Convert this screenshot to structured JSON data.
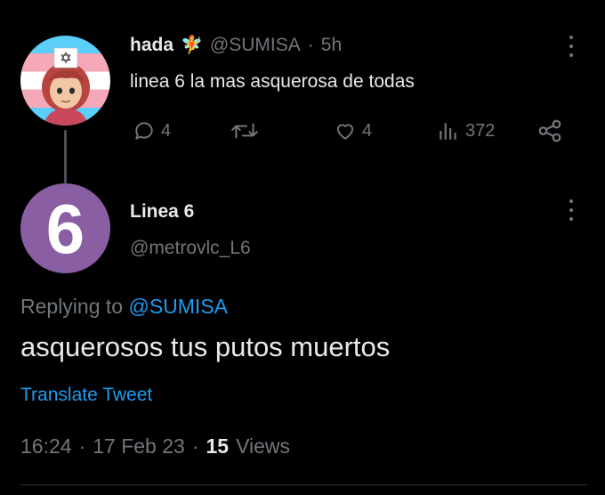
{
  "parent_tweet": {
    "display_name": "hada",
    "name_emoji": "🧚",
    "handle": "@SUMISA",
    "separator": "·",
    "time": "5h",
    "text": "linea 6 la mas asquerosa de todas",
    "actions": {
      "replies": "4",
      "retweets": "",
      "likes": "4",
      "views": "372"
    },
    "avatar_flag_colors": [
      "#5bcefa",
      "#f5a9b8",
      "#ffffff"
    ]
  },
  "main_tweet": {
    "display_name": "Linea 6",
    "handle": "@metrovlc_L6",
    "avatar_text": "6",
    "avatar_color": "#8a5ea2",
    "replying_prefix": "Replying to",
    "replying_handle": "@SUMISA",
    "text": "asquerosos tus putos muertos",
    "translate_label": "Translate Tweet",
    "time": "16:24",
    "separator": "·",
    "date": "17 Feb 23",
    "views_count": "15",
    "views_label": "Views"
  },
  "colors": {
    "background": "#000000",
    "text": "#e7e9ea",
    "muted": "#71767b",
    "link": "#1d9bf0",
    "divider": "#2f3336"
  }
}
